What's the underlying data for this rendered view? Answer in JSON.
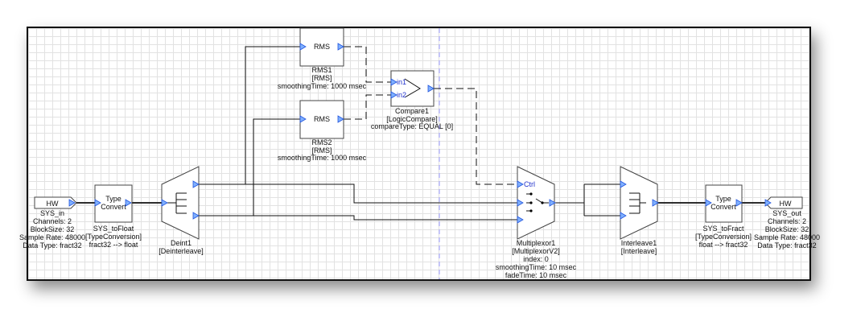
{
  "colors": {
    "port": "#7fb0ff",
    "grid": "#e2e2e2",
    "divider": "#9999ff"
  },
  "blocks": {
    "sys_in": {
      "glyph": "HW",
      "name": "SYS_in",
      "lines": [
        "Channels: 2",
        "BlockSize: 32",
        "Sample Rate: 48000",
        "Data Type: fract32"
      ]
    },
    "to_float": {
      "glyph": [
        "Type",
        "Convert"
      ],
      "name": "SYS_toFloat",
      "type": "[TypeConversion]",
      "param": "fract32 --> float"
    },
    "deint": {
      "name": "Deint1",
      "type": "[Deinterleave]"
    },
    "rms1": {
      "glyph": "RMS",
      "name": "RMS1",
      "type": "[RMS]",
      "param": "smoothingTime: 1000 msec"
    },
    "rms2": {
      "glyph": "RMS",
      "name": "RMS2",
      "type": "[RMS]",
      "param": "smoothingTime: 1000 msec"
    },
    "compare": {
      "in1": "in1",
      "in2": "in2",
      "name": "Compare1",
      "type": "[LogicCompare]",
      "param": "compareType: EQUAL [0]"
    },
    "mux": {
      "ctrl": "Ctrl",
      "name": "Multiplexor1",
      "type": "[MultiplexorV2]",
      "lines": [
        "index: 0",
        "smoothingTime: 10 msec",
        "fadeTime: 10 msec"
      ]
    },
    "interleave": {
      "name": "Interleave1",
      "type": "[Interleave]"
    },
    "to_fract": {
      "glyph": [
        "Type",
        "Convert"
      ],
      "name": "SYS_toFract",
      "type": "[TypeConversion]",
      "param": "float --> fract32"
    },
    "sys_out": {
      "glyph": "HW",
      "name": "SYS_out",
      "lines": [
        "Channels: 2",
        "BlockSize: 32",
        "Sample Rate: 48000",
        "Data Type: fract32"
      ]
    }
  }
}
